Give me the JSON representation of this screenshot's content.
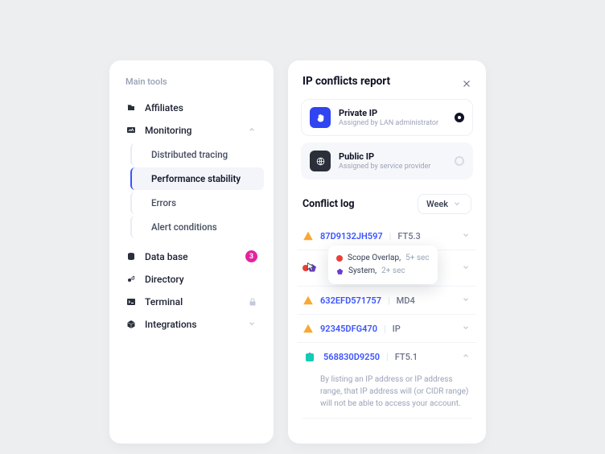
{
  "sidebar": {
    "section_title": "Main tools",
    "items": [
      {
        "label": "Affiliates"
      },
      {
        "label": "Monitoring",
        "expanded": true,
        "children": [
          {
            "label": "Distributed tracing"
          },
          {
            "label": "Performance stability",
            "active": true
          },
          {
            "label": "Errors"
          },
          {
            "label": "Alert conditions"
          }
        ]
      },
      {
        "label": "Data base",
        "badge": "3"
      },
      {
        "label": "Directory"
      },
      {
        "label": "Terminal",
        "locked": true
      },
      {
        "label": "Integrations",
        "expandable": true
      }
    ]
  },
  "panel": {
    "title": "IP conflicts report",
    "options": [
      {
        "title": "Private IP",
        "subtitle": "Assigned by LAN administrator",
        "selected": true
      },
      {
        "title": "Public IP",
        "subtitle": "Assigned by service provider",
        "selected": false
      }
    ],
    "log_title": "Conflict log",
    "range": "Week",
    "tooltip": {
      "rows": [
        {
          "label": "Scope Overlap,",
          "time": "5+ sec",
          "color": "#e8403a"
        },
        {
          "label": "System,",
          "time": "2+ sec",
          "color": "#6b3bd6"
        }
      ]
    },
    "log": [
      {
        "type": "warn",
        "code": "87D9132JH597",
        "meta": "FT5.3"
      },
      {
        "type": "tooltip-row"
      },
      {
        "type": "warn",
        "code": "632EFD571757",
        "meta": "MD4"
      },
      {
        "type": "warn",
        "code": "92345DFG470",
        "meta": "IP"
      },
      {
        "type": "poly",
        "code": "568830D9250",
        "meta": "FT5.1",
        "expanded": true,
        "description": "By listing an IP address or IP address range, that IP address will (or CIDR range) will not be able to access your account."
      }
    ]
  }
}
